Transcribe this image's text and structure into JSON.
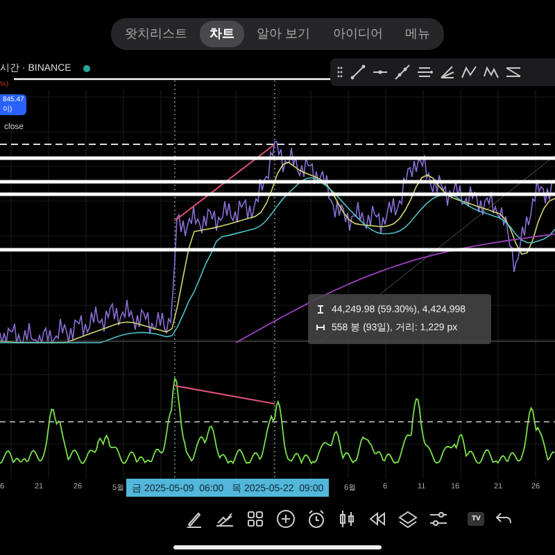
{
  "nav_tabs": [
    {
      "label": "왓치리스트",
      "selected": false
    },
    {
      "label": "차트",
      "selected": true
    },
    {
      "label": "알아 보기",
      "selected": false
    },
    {
      "label": "아이디어",
      "selected": false
    },
    {
      "label": "메뉴",
      "selected": false
    }
  ],
  "symbol": {
    "title": "시간 · BINANCE",
    "change": "%)"
  },
  "price_badge": {
    "price": "845.47",
    "caption": "이)"
  },
  "legend_label": "close",
  "measure": {
    "price_range": "44,249.98 (59.30%), 4,424,998",
    "bar_range": "558 봉 (93일), 거리: 1,229 px"
  },
  "time_axis": [
    {
      "label": "6",
      "kind": "tick"
    },
    {
      "label": "21",
      "kind": "tick"
    },
    {
      "label": "26",
      "kind": "tick"
    },
    {
      "label": "5월",
      "kind": "tick"
    },
    {
      "label": "금 2025-05-09  06:00",
      "kind": "marker"
    },
    {
      "label": "목 2025-05-22  09:00",
      "kind": "marker"
    },
    {
      "label": "6월",
      "kind": "tick"
    },
    {
      "label": "6",
      "kind": "tick"
    },
    {
      "label": "11",
      "kind": "tick"
    },
    {
      "label": "16",
      "kind": "tick"
    },
    {
      "label": "21",
      "kind": "tick"
    },
    {
      "label": "26",
      "kind": "tick"
    }
  ],
  "logo": "TV"
}
